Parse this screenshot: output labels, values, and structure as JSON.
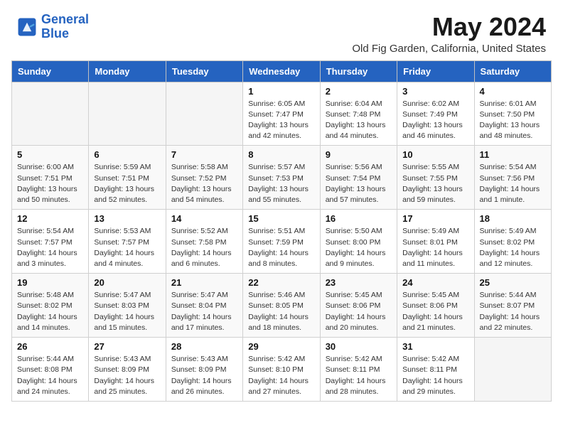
{
  "header": {
    "logo_line1": "General",
    "logo_line2": "Blue",
    "month": "May 2024",
    "location": "Old Fig Garden, California, United States"
  },
  "weekdays": [
    "Sunday",
    "Monday",
    "Tuesday",
    "Wednesday",
    "Thursday",
    "Friday",
    "Saturday"
  ],
  "weeks": [
    [
      {
        "day": "",
        "info": ""
      },
      {
        "day": "",
        "info": ""
      },
      {
        "day": "",
        "info": ""
      },
      {
        "day": "1",
        "info": "Sunrise: 6:05 AM\nSunset: 7:47 PM\nDaylight: 13 hours\nand 42 minutes."
      },
      {
        "day": "2",
        "info": "Sunrise: 6:04 AM\nSunset: 7:48 PM\nDaylight: 13 hours\nand 44 minutes."
      },
      {
        "day": "3",
        "info": "Sunrise: 6:02 AM\nSunset: 7:49 PM\nDaylight: 13 hours\nand 46 minutes."
      },
      {
        "day": "4",
        "info": "Sunrise: 6:01 AM\nSunset: 7:50 PM\nDaylight: 13 hours\nand 48 minutes."
      }
    ],
    [
      {
        "day": "5",
        "info": "Sunrise: 6:00 AM\nSunset: 7:51 PM\nDaylight: 13 hours\nand 50 minutes."
      },
      {
        "day": "6",
        "info": "Sunrise: 5:59 AM\nSunset: 7:51 PM\nDaylight: 13 hours\nand 52 minutes."
      },
      {
        "day": "7",
        "info": "Sunrise: 5:58 AM\nSunset: 7:52 PM\nDaylight: 13 hours\nand 54 minutes."
      },
      {
        "day": "8",
        "info": "Sunrise: 5:57 AM\nSunset: 7:53 PM\nDaylight: 13 hours\nand 55 minutes."
      },
      {
        "day": "9",
        "info": "Sunrise: 5:56 AM\nSunset: 7:54 PM\nDaylight: 13 hours\nand 57 minutes."
      },
      {
        "day": "10",
        "info": "Sunrise: 5:55 AM\nSunset: 7:55 PM\nDaylight: 13 hours\nand 59 minutes."
      },
      {
        "day": "11",
        "info": "Sunrise: 5:54 AM\nSunset: 7:56 PM\nDaylight: 14 hours\nand 1 minute."
      }
    ],
    [
      {
        "day": "12",
        "info": "Sunrise: 5:54 AM\nSunset: 7:57 PM\nDaylight: 14 hours\nand 3 minutes."
      },
      {
        "day": "13",
        "info": "Sunrise: 5:53 AM\nSunset: 7:57 PM\nDaylight: 14 hours\nand 4 minutes."
      },
      {
        "day": "14",
        "info": "Sunrise: 5:52 AM\nSunset: 7:58 PM\nDaylight: 14 hours\nand 6 minutes."
      },
      {
        "day": "15",
        "info": "Sunrise: 5:51 AM\nSunset: 7:59 PM\nDaylight: 14 hours\nand 8 minutes."
      },
      {
        "day": "16",
        "info": "Sunrise: 5:50 AM\nSunset: 8:00 PM\nDaylight: 14 hours\nand 9 minutes."
      },
      {
        "day": "17",
        "info": "Sunrise: 5:49 AM\nSunset: 8:01 PM\nDaylight: 14 hours\nand 11 minutes."
      },
      {
        "day": "18",
        "info": "Sunrise: 5:49 AM\nSunset: 8:02 PM\nDaylight: 14 hours\nand 12 minutes."
      }
    ],
    [
      {
        "day": "19",
        "info": "Sunrise: 5:48 AM\nSunset: 8:02 PM\nDaylight: 14 hours\nand 14 minutes."
      },
      {
        "day": "20",
        "info": "Sunrise: 5:47 AM\nSunset: 8:03 PM\nDaylight: 14 hours\nand 15 minutes."
      },
      {
        "day": "21",
        "info": "Sunrise: 5:47 AM\nSunset: 8:04 PM\nDaylight: 14 hours\nand 17 minutes."
      },
      {
        "day": "22",
        "info": "Sunrise: 5:46 AM\nSunset: 8:05 PM\nDaylight: 14 hours\nand 18 minutes."
      },
      {
        "day": "23",
        "info": "Sunrise: 5:45 AM\nSunset: 8:06 PM\nDaylight: 14 hours\nand 20 minutes."
      },
      {
        "day": "24",
        "info": "Sunrise: 5:45 AM\nSunset: 8:06 PM\nDaylight: 14 hours\nand 21 minutes."
      },
      {
        "day": "25",
        "info": "Sunrise: 5:44 AM\nSunset: 8:07 PM\nDaylight: 14 hours\nand 22 minutes."
      }
    ],
    [
      {
        "day": "26",
        "info": "Sunrise: 5:44 AM\nSunset: 8:08 PM\nDaylight: 14 hours\nand 24 minutes."
      },
      {
        "day": "27",
        "info": "Sunrise: 5:43 AM\nSunset: 8:09 PM\nDaylight: 14 hours\nand 25 minutes."
      },
      {
        "day": "28",
        "info": "Sunrise: 5:43 AM\nSunset: 8:09 PM\nDaylight: 14 hours\nand 26 minutes."
      },
      {
        "day": "29",
        "info": "Sunrise: 5:42 AM\nSunset: 8:10 PM\nDaylight: 14 hours\nand 27 minutes."
      },
      {
        "day": "30",
        "info": "Sunrise: 5:42 AM\nSunset: 8:11 PM\nDaylight: 14 hours\nand 28 minutes."
      },
      {
        "day": "31",
        "info": "Sunrise: 5:42 AM\nSunset: 8:11 PM\nDaylight: 14 hours\nand 29 minutes."
      },
      {
        "day": "",
        "info": ""
      }
    ]
  ]
}
